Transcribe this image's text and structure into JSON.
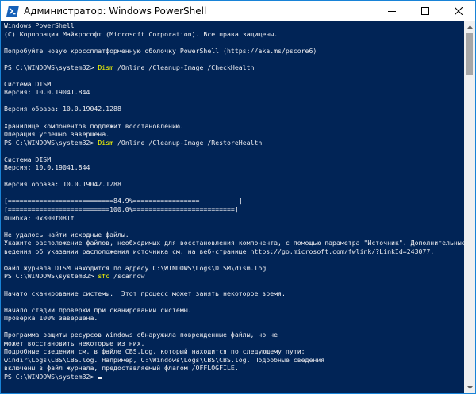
{
  "window": {
    "title": "Администратор: Windows PowerShell",
    "icon": "powershell-icon",
    "controls": [
      "minimize-icon",
      "maximize-icon",
      "close-icon"
    ]
  },
  "colors": {
    "console_bg": "#012456",
    "text": "#eeedf0",
    "command": "#ffff00",
    "titlebar_bg": "#ffffff",
    "border": "#1883d7"
  },
  "console": {
    "lines": [
      {
        "text": "Windows PowerShell"
      },
      {
        "text": "(C) Корпорация Майкрософт (Microsoft Corporation). Все права защищены."
      },
      {
        "text": ""
      },
      {
        "text": "Попробуйте новую кроссплатформенную оболочку PowerShell (https://aka.ms/pscore6)"
      },
      {
        "text": ""
      },
      {
        "prompt": "PS C:\\WINDOWS\\system32> ",
        "cmd": "Dism",
        "args": " /Online /Cleanup-Image /CheckHealth"
      },
      {
        "text": ""
      },
      {
        "text": "Система DISM"
      },
      {
        "text": "Версия: 10.0.19041.844"
      },
      {
        "text": ""
      },
      {
        "text": "Версия образа: 10.0.19042.1288"
      },
      {
        "text": ""
      },
      {
        "text": "Хранилище компонентов подлежит восстановлению."
      },
      {
        "text": "Операция успешно завершена."
      },
      {
        "prompt": "PS C:\\WINDOWS\\system32> ",
        "cmd": "Dism",
        "args": " /Online /Cleanup-Image /RestoreHealth"
      },
      {
        "text": ""
      },
      {
        "text": "Система DISM"
      },
      {
        "text": "Версия: 10.0.19041.844"
      },
      {
        "text": ""
      },
      {
        "text": "Версия образа: 10.0.19042.1288"
      },
      {
        "text": ""
      },
      {
        "text": "[===========================84.9%=================          ]"
      },
      {
        "text": "[==========================100.0%==========================]"
      },
      {
        "text": "Ошибка: 0x800f081f"
      },
      {
        "text": ""
      },
      {
        "text": "Не удалось найти исходные файлы."
      },
      {
        "text": "Укажите расположение файлов, необходимых для восстановления компонента, с помощью параметра \"Источник\". Дополнительные с"
      },
      {
        "text": "ведения об указании расположения источника см. на веб-странице https://go.microsoft.com/fwlink/?LinkId=243077."
      },
      {
        "text": ""
      },
      {
        "text": "Файл журнала DISM находится по адресу C:\\WINDOWS\\Logs\\DISM\\dism.log"
      },
      {
        "prompt": "PS C:\\WINDOWS\\system32> ",
        "cmd": "sfc",
        "args": " /scannow"
      },
      {
        "text": ""
      },
      {
        "text": "Начато сканирование системы.  Этот процесс может занять некоторое время."
      },
      {
        "text": ""
      },
      {
        "text": "Начало стадии проверки при сканировании системы."
      },
      {
        "text": "Проверка 100% завершена."
      },
      {
        "text": ""
      },
      {
        "text": "Программа защиты ресурсов Windows обнаружила поврежденные файлы, но не"
      },
      {
        "text": "может восстановить некоторые из них."
      },
      {
        "text": "Подробные сведения см. в файле CBS.Log, который находится по следующему пути:"
      },
      {
        "text": "windir\\Logs\\CBS\\CBS.log. Например, C:\\Windows\\Logs\\CBS\\CBS.log. Подробные сведения"
      },
      {
        "text": "включены в файл журнала, предоставляемый флагом /OFFLOGFILE."
      },
      {
        "prompt": "PS C:\\WINDOWS\\system32> ",
        "cmd": "",
        "args": "",
        "cursor": true
      }
    ]
  },
  "scrollbar": {
    "position_fraction": 0.0,
    "visible_fraction": 0.12
  }
}
